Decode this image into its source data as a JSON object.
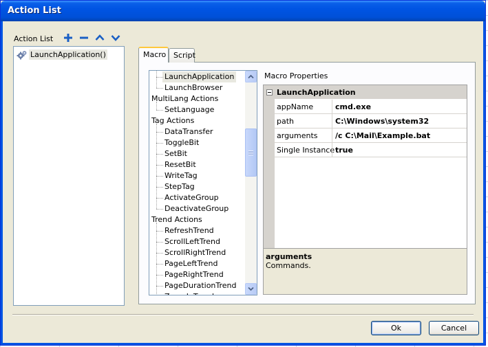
{
  "window": {
    "title": "Action List"
  },
  "action_list": {
    "label": "Action List",
    "items": [
      {
        "label": "LaunchApplication()",
        "icon": "gear-icon"
      }
    ]
  },
  "toolbar": {
    "add_icon": "plus-icon",
    "remove_icon": "minus-icon",
    "up_icon": "chevron-up-icon",
    "down_icon": "chevron-down-icon",
    "accent": "#1a5fc4"
  },
  "tabs": [
    {
      "label": "Macro",
      "active": true
    },
    {
      "label": "Script",
      "active": false
    }
  ],
  "macro_tree": {
    "rows": [
      {
        "label": "LaunchApplication",
        "level": 1,
        "selected": true
      },
      {
        "label": "LaunchBrowser",
        "level": 1
      },
      {
        "label": "MultiLang Actions",
        "level": 0
      },
      {
        "label": "SetLanguage",
        "level": 1
      },
      {
        "label": "Tag Actions",
        "level": 0
      },
      {
        "label": "DataTransfer",
        "level": 1
      },
      {
        "label": "ToggleBit",
        "level": 1
      },
      {
        "label": "SetBit",
        "level": 1
      },
      {
        "label": "ResetBit",
        "level": 1
      },
      {
        "label": "WriteTag",
        "level": 1
      },
      {
        "label": "StepTag",
        "level": 1
      },
      {
        "label": "ActivateGroup",
        "level": 1
      },
      {
        "label": "DeactivateGroup",
        "level": 1
      },
      {
        "label": "Trend Actions",
        "level": 0
      },
      {
        "label": "RefreshTrend",
        "level": 1
      },
      {
        "label": "ScrollLeftTrend",
        "level": 1
      },
      {
        "label": "ScrollRightTrend",
        "level": 1
      },
      {
        "label": "PageLeftTrend",
        "level": 1
      },
      {
        "label": "PageRightTrend",
        "level": 1
      },
      {
        "label": "PageDurationTrend",
        "level": 1
      },
      {
        "label": "ZoomInTrend",
        "level": 1
      }
    ]
  },
  "macro_properties": {
    "label": "Macro Properties",
    "category": "LaunchApplication",
    "properties": [
      {
        "name": "appName",
        "value": "cmd.exe"
      },
      {
        "name": "path",
        "value": "C:\\Windows\\system32"
      },
      {
        "name": "arguments",
        "value": "/c C:\\Mail\\Example.bat"
      },
      {
        "name": "Single Instance",
        "value": "true"
      }
    ],
    "description": {
      "title": "arguments",
      "text": "Commands."
    }
  },
  "buttons": {
    "ok": "Ok",
    "cancel": "Cancel"
  }
}
